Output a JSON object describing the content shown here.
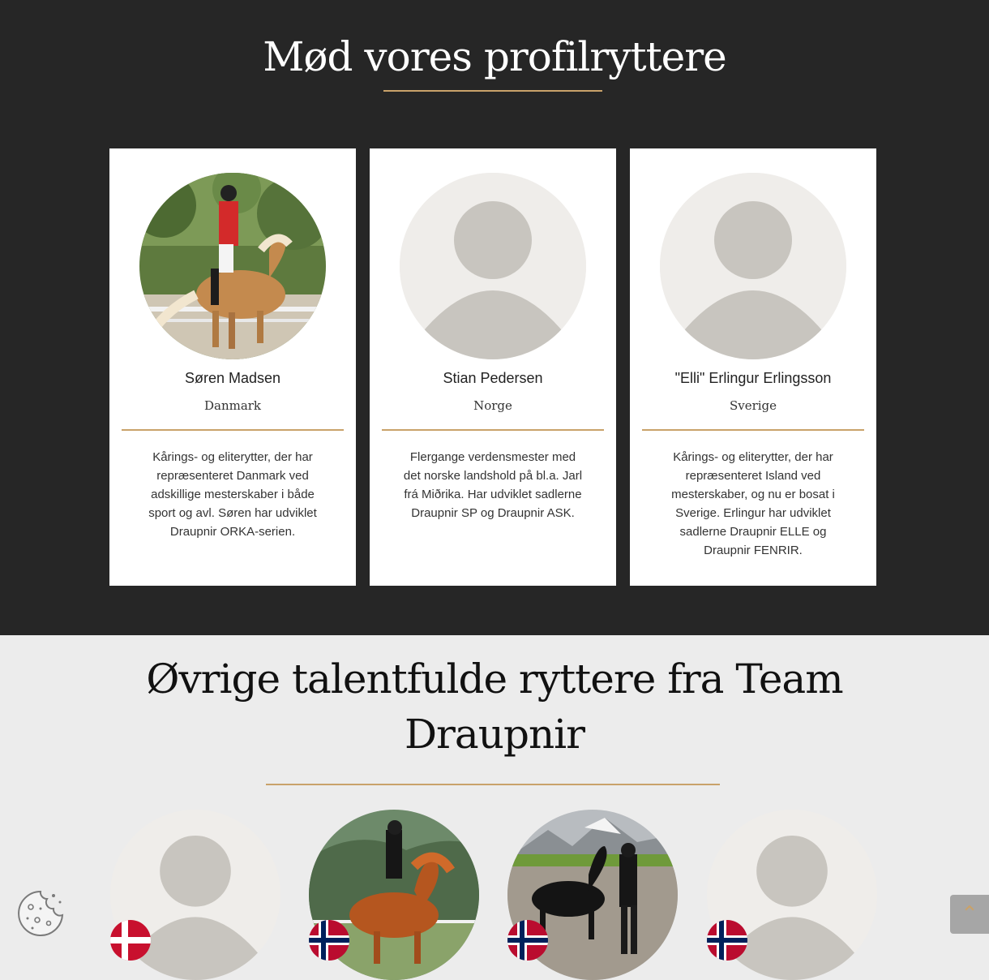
{
  "section_profile": {
    "title": "Mød vores profilryttere",
    "riders": [
      {
        "name": "Søren Madsen",
        "country": "Danmark",
        "description": "Kårings- og eliterytter, der har repræsenteret Danmark ved adskillige mesterskaber i både sport og avl. Søren har udviklet Draupnir ORKA-serien."
      },
      {
        "name": "Stian Pedersen",
        "country": "Norge",
        "description": "Flergange verdensmester med det norske landshold på bl.a. Jarl frá Miðrika. Har udviklet sadlerne Draupnir SP og Draupnir ASK."
      },
      {
        "name": "\"Elli\" Erlingur Erlingsson",
        "country": "Sverige",
        "description": "Kårings- og eliterytter, der har repræsenteret Island ved mesterskaber, og nu er bosat i Sverige. Erlingur har udviklet sadlerne Draupnir ELLE og Draupnir FENRIR."
      }
    ]
  },
  "section_other": {
    "title": "Øvrige talentfulde ryttere fra Team Draupnir",
    "riders": [
      {
        "flag": "denmark-flag-icon",
        "photo": "placeholder-avatar"
      },
      {
        "flag": "norway-flag-icon",
        "photo": "rider-on-chestnut-horse-photo"
      },
      {
        "flag": "norway-flag-icon",
        "photo": "rider-with-black-horse-photo"
      },
      {
        "flag": "norway-flag-icon",
        "photo": "placeholder-avatar"
      }
    ]
  },
  "widgets": {
    "cookie_icon": "cookie-icon",
    "back_to_top_icon": "chevron-up-icon",
    "back_to_top_glyph": "⌃"
  },
  "colors": {
    "dark_bg": "#262626",
    "accent": "#c9a26a",
    "light_bg": "#ececec",
    "placeholder_bg": "#efedea",
    "placeholder_figure": "#c8c5bf"
  }
}
